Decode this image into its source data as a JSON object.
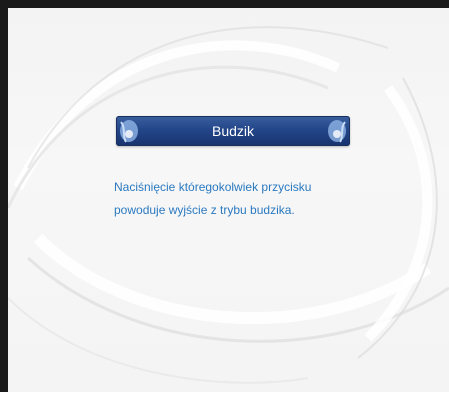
{
  "dialog": {
    "title": "Budzik",
    "message_line1": "Naciśnięcie któregokolwiek przycisku",
    "message_line2": "powoduje wyjście z trybu budzika."
  },
  "colors": {
    "title_bar": "#234689",
    "title_text": "#ffffff",
    "message_text": "#2a79c0",
    "background": "#f4f4f4",
    "frame": "#1a1a1a"
  },
  "icons": {
    "title_left": "ornament-left-icon",
    "title_right": "ornament-right-icon"
  }
}
